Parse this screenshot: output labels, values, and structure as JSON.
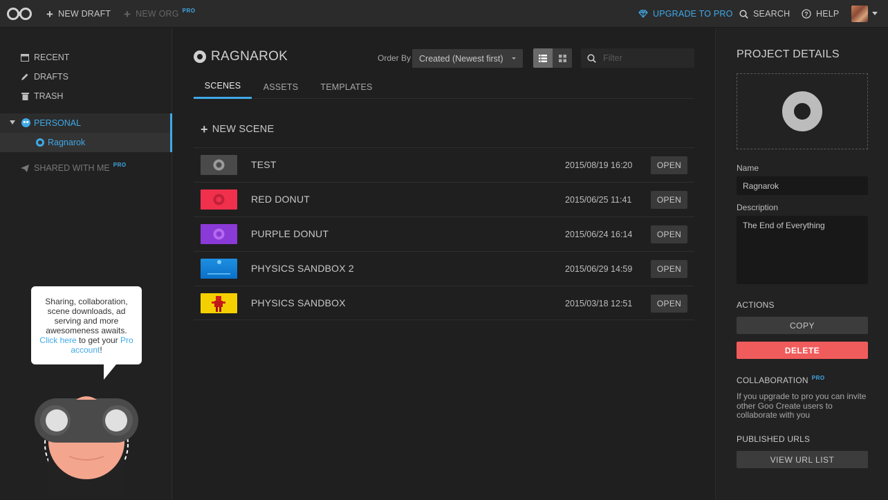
{
  "topbar": {
    "new_draft": "NEW DRAFT",
    "new_org": "NEW ORG",
    "pro_badge": "PRO",
    "upgrade": "UPGRADE TO PRO",
    "search": "SEARCH",
    "help": "HELP"
  },
  "sidebar": {
    "recent": "RECENT",
    "drafts": "DRAFTS",
    "trash": "TRASH",
    "personal": "PERSONAL",
    "project": "Ragnarok",
    "shared": "SHARED WITH ME",
    "pro_badge": "PRO",
    "tooltip_text": "Sharing, collaboration, scene downloads, ad serving and more awesomeness awaits.",
    "tooltip_link1": "Click here",
    "tooltip_mid": " to get your ",
    "tooltip_link2": "Pro account",
    "tooltip_end": "!"
  },
  "main": {
    "title": "RAGNAROK",
    "order_by_label": "Order By",
    "order_by_value": "Created (Newest first)",
    "filter_placeholder": "Filter",
    "tabs": [
      {
        "label": "SCENES"
      },
      {
        "label": "ASSETS"
      },
      {
        "label": "TEMPLATES"
      }
    ],
    "new_scene": "NEW SCENE",
    "open_label": "OPEN",
    "scenes": [
      {
        "name": "TEST",
        "date": "2015/08/19 16:20",
        "thumb_color": "#4a4a4a"
      },
      {
        "name": "RED DONUT",
        "date": "2015/06/25 11:41",
        "thumb_color": "#f0304c"
      },
      {
        "name": "PURPLE DONUT",
        "date": "2015/06/24 16:14",
        "thumb_color": "#8a3ad6"
      },
      {
        "name": "PHYSICS SANDBOX 2",
        "date": "2015/06/29 14:59",
        "thumb_color": "#1e8fe0"
      },
      {
        "name": "PHYSICS SANDBOX",
        "date": "2015/03/18 12:51",
        "thumb_color": "#f5d000"
      }
    ]
  },
  "details": {
    "heading": "PROJECT DETAILS",
    "name_label": "Name",
    "name_value": "Ragnarok",
    "description_label": "Description",
    "description_value": "The End of Everything",
    "actions_label": "ACTIONS",
    "copy": "COPY",
    "delete": "DELETE",
    "collaboration_label": "COLLABORATION",
    "pro_badge": "PRO",
    "collaboration_text": "If you upgrade to pro you can invite other Goo Create users to collaborate with you",
    "published_label": "PUBLISHED URLS",
    "view_url_list": "VIEW URL LIST"
  },
  "colors": {
    "accent": "#3fa9e8",
    "delete": "#f05c5c"
  }
}
